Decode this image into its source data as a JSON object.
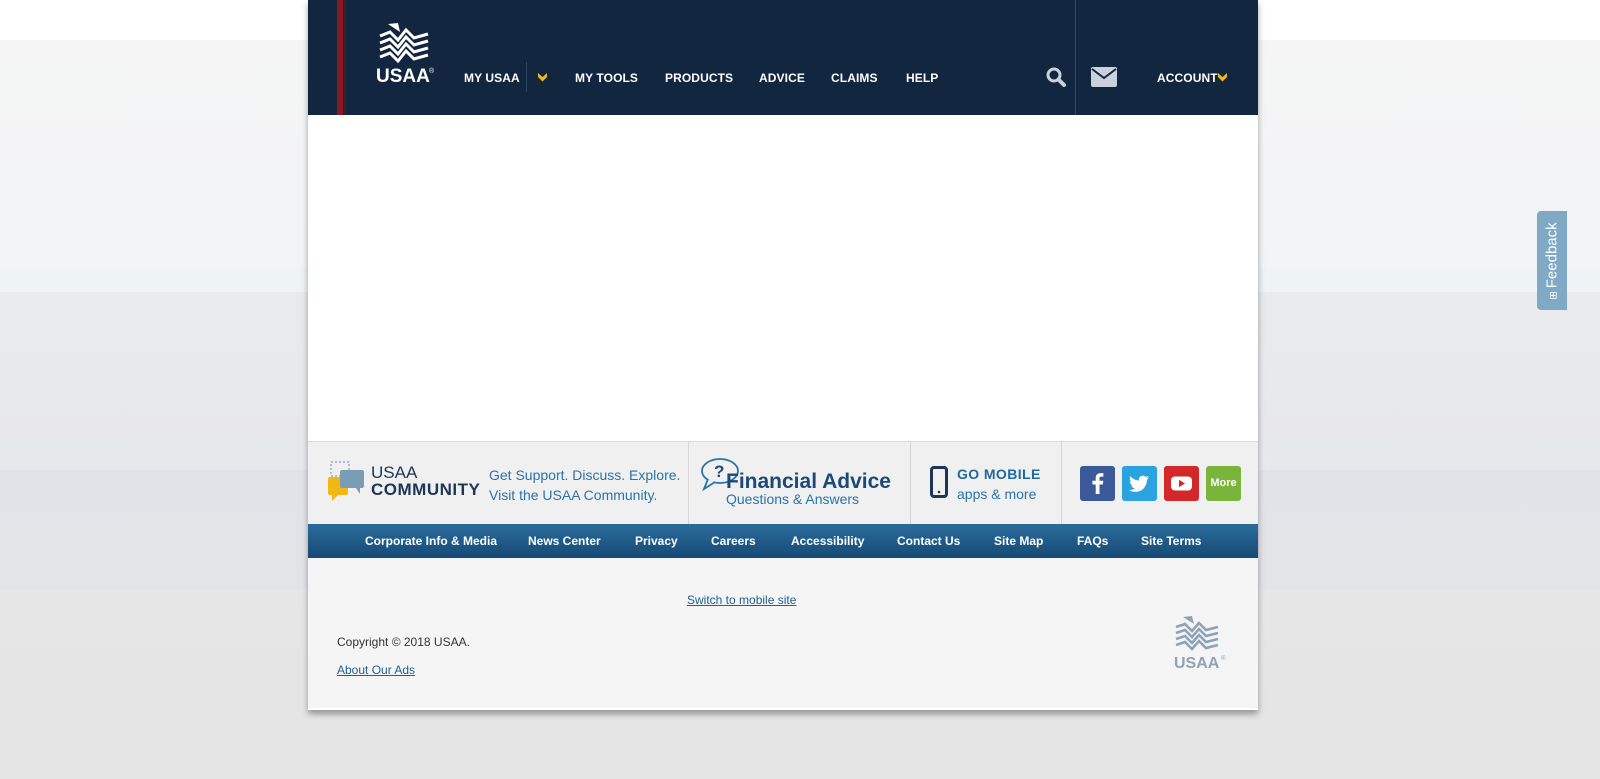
{
  "header": {
    "logo_text": "USAA",
    "nav": [
      {
        "label": "MY USAA"
      },
      {
        "label": "MY TOOLS"
      },
      {
        "label": "PRODUCTS"
      },
      {
        "label": "ADVICE"
      },
      {
        "label": "CLAIMS"
      },
      {
        "label": "HELP"
      }
    ],
    "account_label": "ACCOUNT",
    "icons": [
      "search-icon",
      "mail-icon",
      "chevron-down-icon"
    ],
    "colors": {
      "background": "#12263f",
      "accent": "#f1b814",
      "red_bar": "#8a1824"
    }
  },
  "footer_strip": {
    "community": {
      "title_line1": "USAA",
      "title_line2": "COMMUNITY",
      "text_line1": "Get Support. Discuss. Explore.",
      "text_line2": "Visit the USAA Community."
    },
    "financial_advice": {
      "title": "Financial Advice",
      "subtitle": "Questions & Answers"
    },
    "mobile": {
      "title": "GO MOBILE",
      "subtitle": "apps & more"
    },
    "social": {
      "facebook": "facebook-icon",
      "twitter": "twitter-icon",
      "youtube": "youtube-icon",
      "more_label": "More"
    }
  },
  "footer_links": [
    "Corporate Info & Media",
    "News Center",
    "Privacy",
    "Careers",
    "Accessibility",
    "Contact Us",
    "Site Map",
    "FAQs",
    "Site Terms"
  ],
  "bottom": {
    "switch_mobile": "Switch to mobile site",
    "copyright": "Copyright © 2018 USAA.",
    "about_ads": "About Our Ads",
    "logo_text": "USAA"
  },
  "feedback": {
    "label": "Feedback",
    "icon": "plus-icon"
  }
}
